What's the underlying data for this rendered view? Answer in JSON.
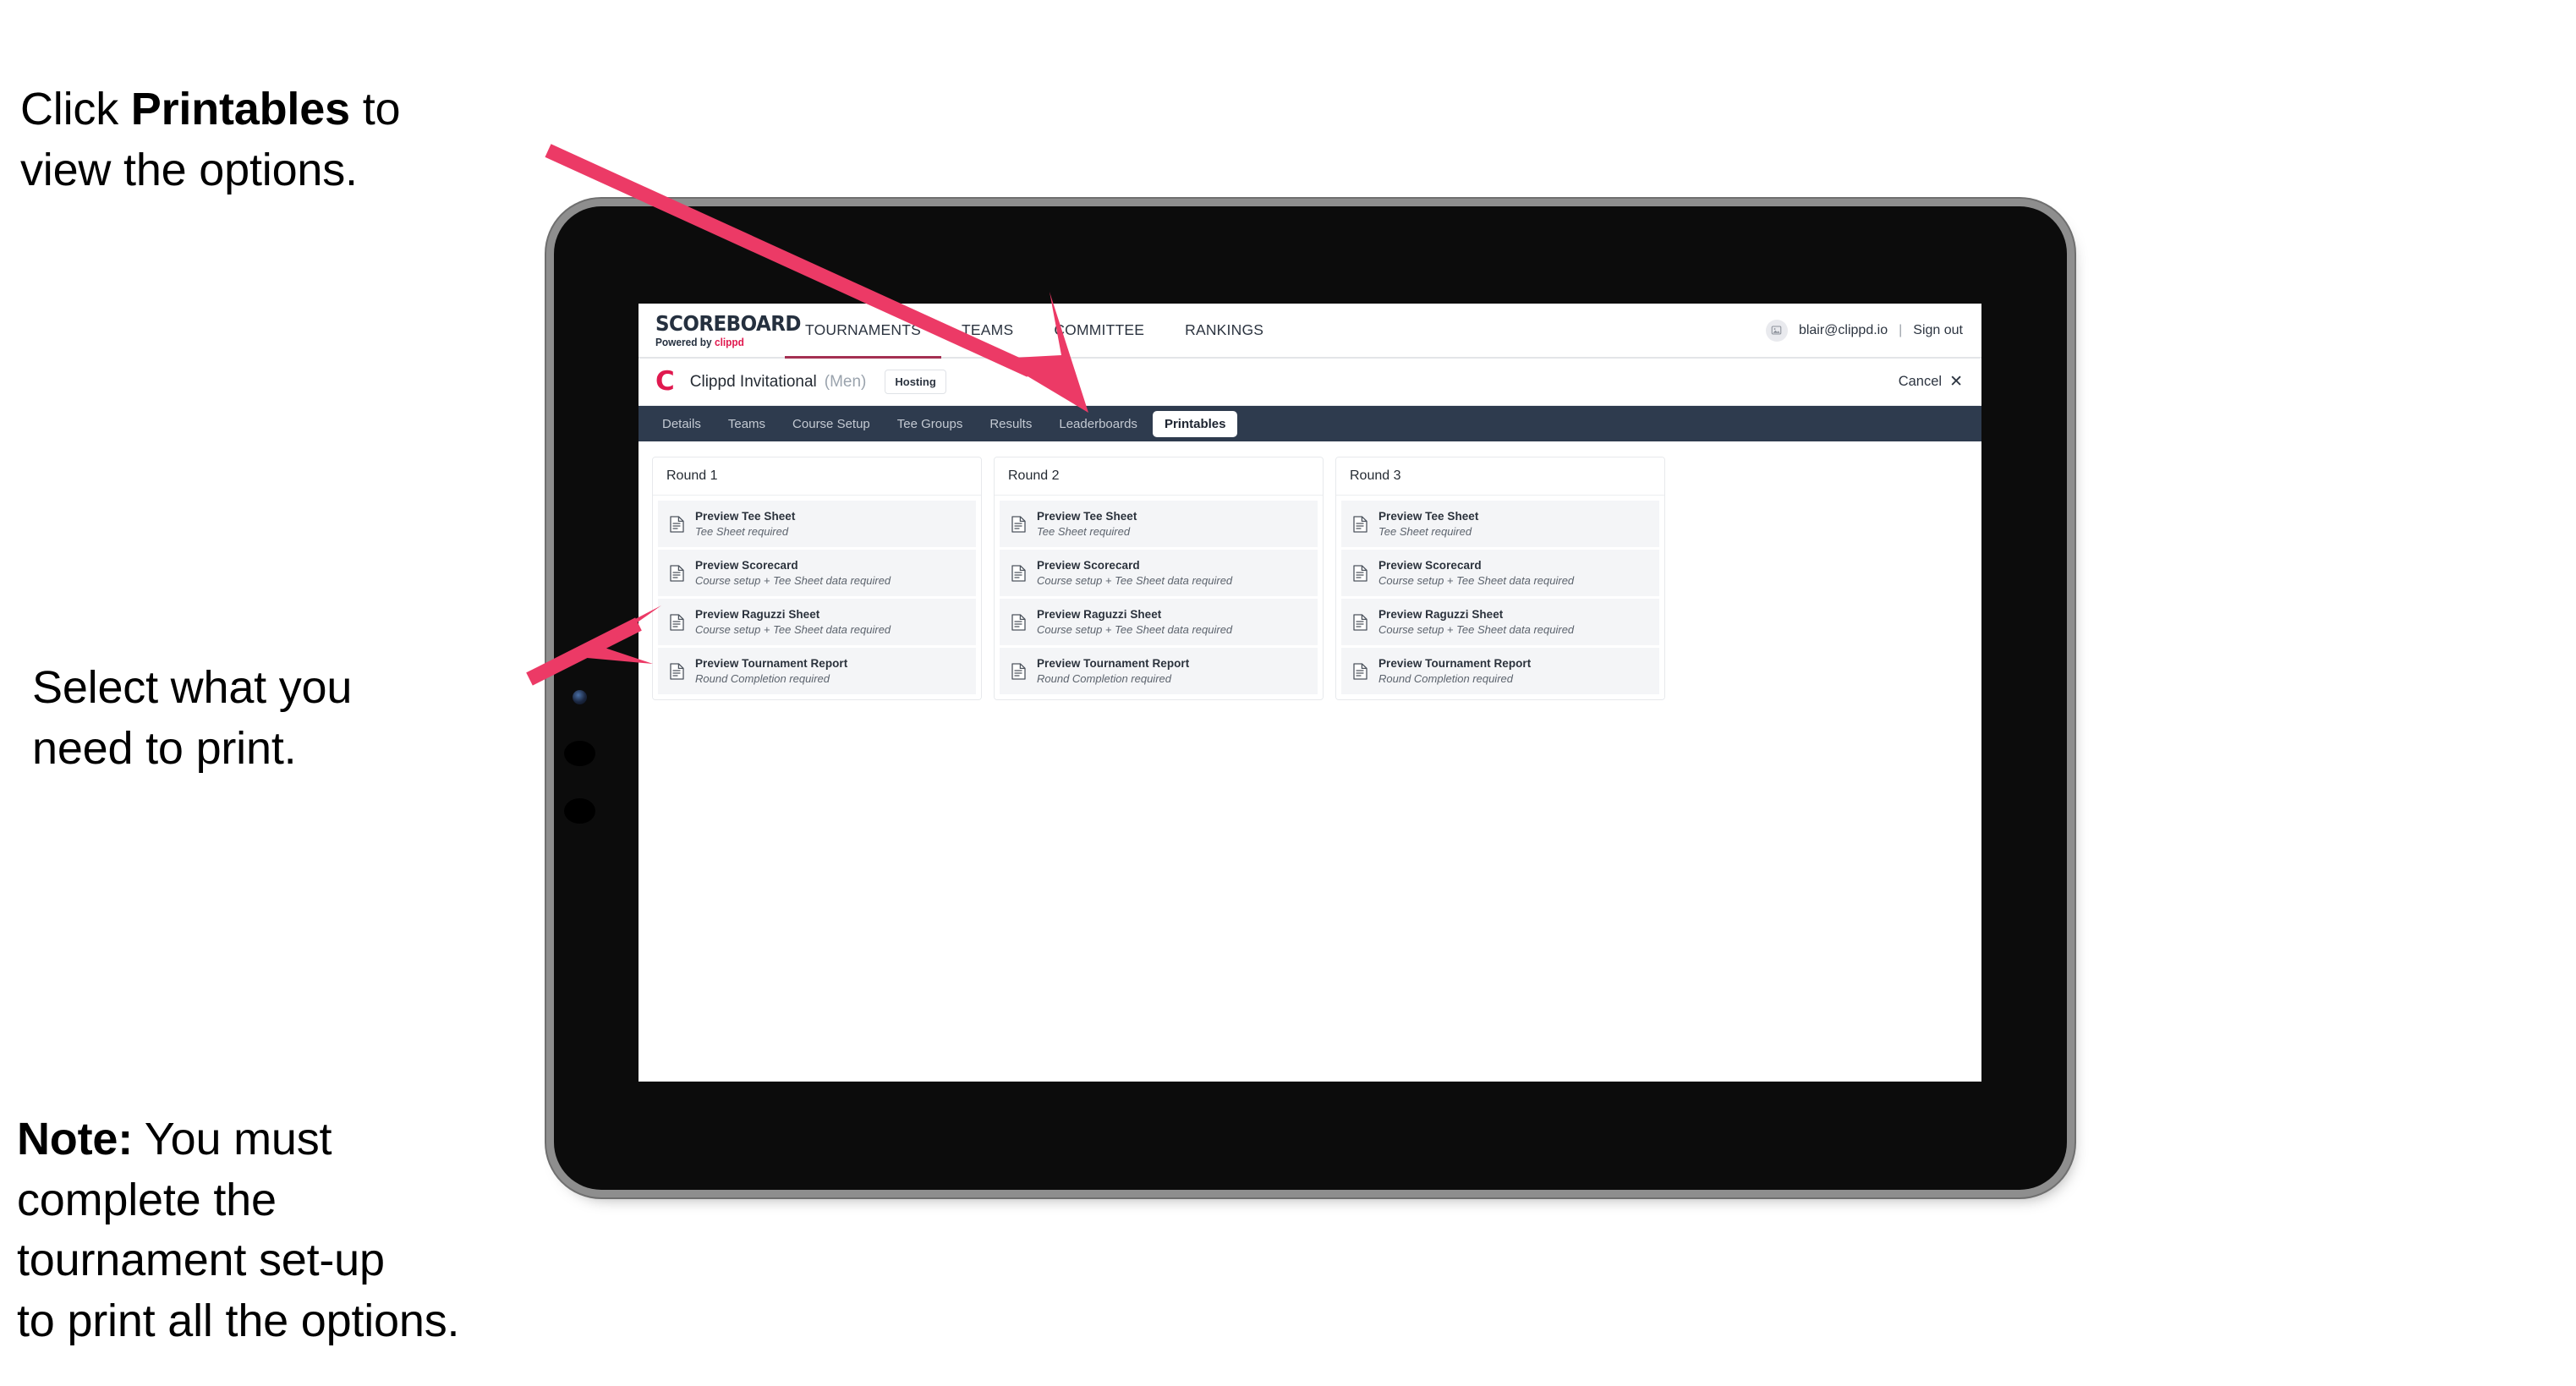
{
  "annotations": {
    "click_printables": "Click Printables to\nview the options.",
    "click_printables_pre": "Click ",
    "click_printables_bold": "Printables",
    "click_printables_post": " to\nview the options.",
    "select_print": "Select what you\nneed to print.",
    "note_bold": "Note:",
    "note_rest": " You must\ncomplete the\ntournament set-up\nto print all the options.",
    "arrow_color": "#ec3a66"
  },
  "device": {
    "bezel_color": "#0c0c0c",
    "frame_color": "#8e8e8e",
    "camera_name": "front-camera",
    "buttons": [
      "volume-up-button",
      "volume-down-button"
    ]
  },
  "app": {
    "logo": {
      "title": "SCOREBOARD",
      "powered_prefix": "Powered by ",
      "brand": "clippd"
    },
    "nav": [
      {
        "label": "TOURNAMENTS",
        "active": true
      },
      {
        "label": "TEAMS",
        "active": false
      },
      {
        "label": "COMMITTEE",
        "active": false
      },
      {
        "label": "RANKINGS",
        "active": false
      }
    ],
    "account": {
      "avatar_icon": "user-avatar-icon",
      "email": "blair@clippd.io",
      "separator": "|",
      "sign_out": "Sign out"
    },
    "tournament": {
      "brand_mark": "C",
      "name": "Clippd Invitational",
      "gender": "(Men)",
      "status_badge": "Hosting",
      "cancel_label": "Cancel",
      "cancel_icon": "✕"
    },
    "tabs": [
      {
        "label": "Details",
        "active": false
      },
      {
        "label": "Teams",
        "active": false
      },
      {
        "label": "Course Setup",
        "active": false
      },
      {
        "label": "Tee Groups",
        "active": false
      },
      {
        "label": "Results",
        "active": false
      },
      {
        "label": "Leaderboards",
        "active": false
      },
      {
        "label": "Printables",
        "active": true
      }
    ],
    "rounds": [
      {
        "title": "Round 1",
        "items": [
          {
            "title": "Preview Tee Sheet",
            "subtitle": "Tee Sheet required"
          },
          {
            "title": "Preview Scorecard",
            "subtitle": "Course setup + Tee Sheet data required"
          },
          {
            "title": "Preview Raguzzi Sheet",
            "subtitle": "Course setup + Tee Sheet data required"
          },
          {
            "title": "Preview Tournament Report",
            "subtitle": "Round Completion required"
          }
        ]
      },
      {
        "title": "Round 2",
        "items": [
          {
            "title": "Preview Tee Sheet",
            "subtitle": "Tee Sheet required"
          },
          {
            "title": "Preview Scorecard",
            "subtitle": "Course setup + Tee Sheet data required"
          },
          {
            "title": "Preview Raguzzi Sheet",
            "subtitle": "Course setup + Tee Sheet data required"
          },
          {
            "title": "Preview Tournament Report",
            "subtitle": "Round Completion required"
          }
        ]
      },
      {
        "title": "Round 3",
        "items": [
          {
            "title": "Preview Tee Sheet",
            "subtitle": "Tee Sheet required"
          },
          {
            "title": "Preview Scorecard",
            "subtitle": "Course setup + Tee Sheet data required"
          },
          {
            "title": "Preview Raguzzi Sheet",
            "subtitle": "Course setup + Tee Sheet data required"
          },
          {
            "title": "Preview Tournament Report",
            "subtitle": "Round Completion required"
          }
        ]
      }
    ],
    "colors": {
      "tabstrip_bg": "#2e3b4e",
      "brand_pink": "#e0194f",
      "nav_underline": "#a43052",
      "row_bg": "#f4f5f7"
    }
  }
}
